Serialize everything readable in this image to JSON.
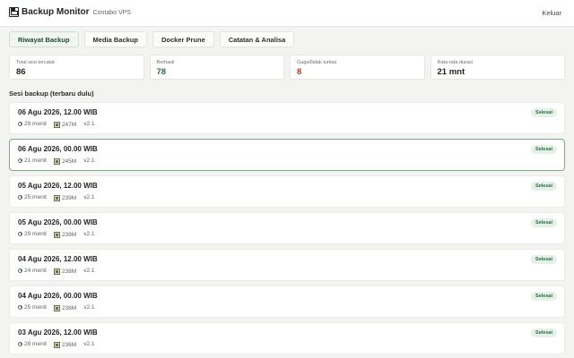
{
  "header": {
    "title": "Backup Monitor",
    "subtitle": "Contabo VPS",
    "logout_label": "Keluar"
  },
  "tabs": [
    {
      "label": "Riwayat Backup",
      "active": true
    },
    {
      "label": "Media Backup",
      "active": false
    },
    {
      "label": "Docker Prune",
      "active": false
    },
    {
      "label": "Catatan & Analisa",
      "active": false
    }
  ],
  "stats": [
    {
      "label": "Total sesi tercatat",
      "value": "86",
      "tone": "default"
    },
    {
      "label": "Berhasil",
      "value": "78",
      "tone": "green"
    },
    {
      "label": "Gagal/tidak tuntas",
      "value": "8",
      "tone": "red"
    },
    {
      "label": "Rata-rata durasi",
      "value": "21 mnt",
      "tone": "default"
    }
  ],
  "sessions_title": "Sesi backup (terbaru dulu)",
  "sessions": [
    {
      "date": "06 Agu 2026, 12.00 WIB",
      "duration": "29 menit",
      "size": "247M",
      "version": "v2.1",
      "status": "Selesai"
    },
    {
      "date": "06 Agu 2026, 00.00 WIB",
      "duration": "21 menit",
      "size": "245M",
      "version": "v2.1",
      "status": "Selesai"
    },
    {
      "date": "05 Agu 2026, 12.00 WIB",
      "duration": "25 menit",
      "size": "239M",
      "version": "v2.1",
      "status": "Selesai"
    },
    {
      "date": "05 Agu 2026, 00.00 WIB",
      "duration": "29 menit",
      "size": "239M",
      "version": "v2.1",
      "status": "Selesai"
    },
    {
      "date": "04 Agu 2026, 12.00 WIB",
      "duration": "24 menit",
      "size": "238M",
      "version": "v2.1",
      "status": "Selesai"
    },
    {
      "date": "04 Agu 2026, 00.00 WIB",
      "duration": "25 menit",
      "size": "238M",
      "version": "v2.1",
      "status": "Selesai"
    },
    {
      "date": "03 Agu 2026, 12.00 WIB",
      "duration": "28 menit",
      "size": "236M",
      "version": "v2.1",
      "status": "Selesai"
    }
  ],
  "colors": {
    "accent": "#2d6a45",
    "danger": "#b5362c",
    "badge_bg": "#e3f1e6"
  },
  "icons": {
    "brand": "floppy-disk-icon",
    "duration": "clock-icon",
    "size": "archive-icon"
  }
}
